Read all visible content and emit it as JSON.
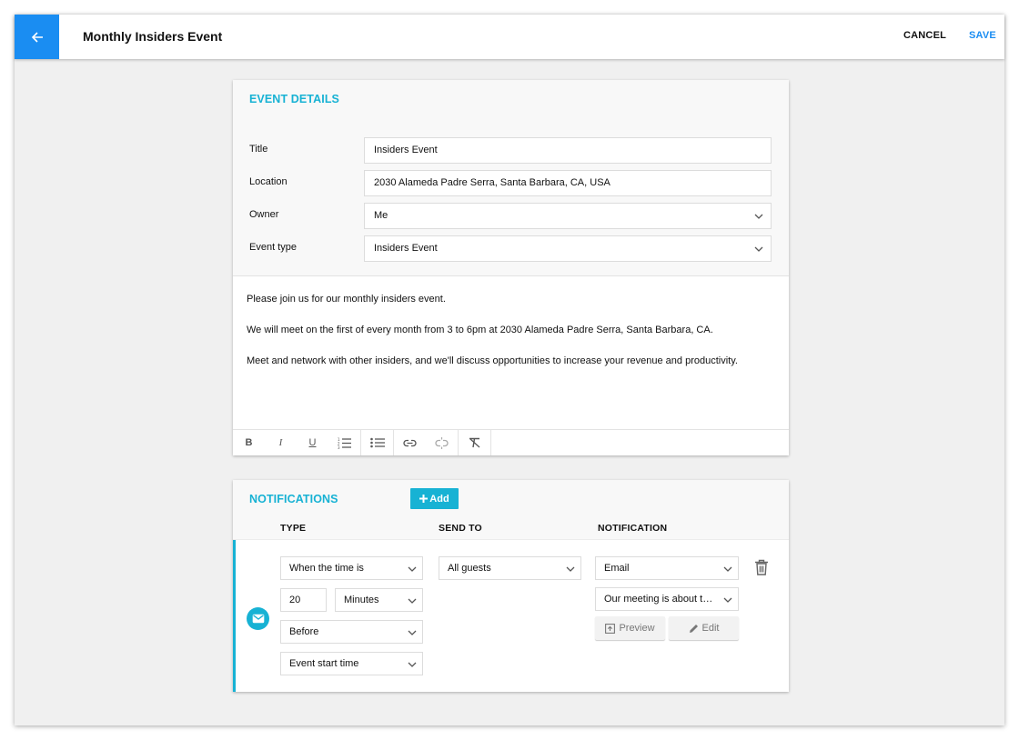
{
  "header": {
    "title": "Monthly Insiders Event",
    "cancel_label": "CANCEL",
    "save_label": "SAVE",
    "back_icon": "arrow-left-icon"
  },
  "event_details": {
    "section_title": "EVENT DETAILS",
    "fields": {
      "title": {
        "label": "Title",
        "value": "Insiders Event"
      },
      "location": {
        "label": "Location",
        "value": "2030 Alameda Padre Serra, Santa Barbara, CA, USA"
      },
      "owner": {
        "label": "Owner",
        "value": "Me"
      },
      "event_type": {
        "label": "Event type",
        "value": "Insiders Event"
      }
    },
    "description": [
      "Please join us for our monthly insiders event.",
      "We will meet on the first of every month from 3 to 6pm at 2030 Alameda Padre Serra, Santa Barbara, CA.",
      "Meet and network with other insiders, and we'll discuss opportunities to increase your revenue and productivity."
    ],
    "toolbar": {
      "bold": "B",
      "italic": "I",
      "underline": "U"
    }
  },
  "notifications": {
    "section_title": "NOTIFICATIONS",
    "add_label": "Add",
    "columns": {
      "type": "TYPE",
      "send_to": "SEND TO",
      "notification": "NOTIFICATION"
    },
    "row": {
      "trigger": "When the time is",
      "amount": "20",
      "unit": "Minutes",
      "relation": "Before",
      "anchor": "Event start time",
      "send_to": "All guests",
      "channel": "Email",
      "template": "Our meeting is about to begin",
      "preview_label": "Preview",
      "edit_label": "Edit"
    }
  },
  "colors": {
    "primary_blue": "#1a8df2",
    "accent_teal": "#17b2d4"
  }
}
